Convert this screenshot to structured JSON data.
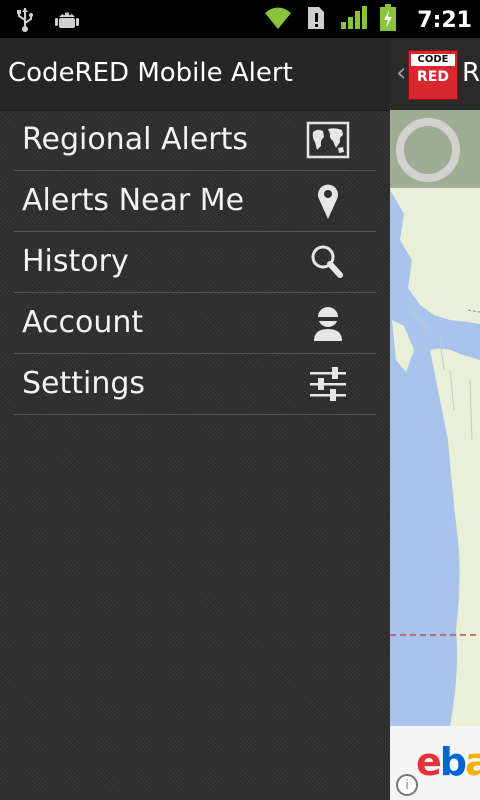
{
  "status_bar": {
    "time": "7:21",
    "icons": [
      "usb-icon",
      "android-debug-icon",
      "wifi-icon",
      "notification-icon",
      "signal-icon",
      "battery-charging-icon"
    ]
  },
  "drawer": {
    "title": "CodeRED Mobile Alert",
    "items": [
      {
        "label": "Regional Alerts",
        "icon": "map-icon"
      },
      {
        "label": "Alerts Near Me",
        "icon": "location-pin-icon"
      },
      {
        "label": "History",
        "icon": "search-icon"
      },
      {
        "label": "Account",
        "icon": "user-icon"
      },
      {
        "label": "Settings",
        "icon": "sliders-icon"
      }
    ]
  },
  "main_screen": {
    "logo": {
      "line1": "CODE",
      "line2": "RED"
    },
    "title_partial": "R",
    "ad_text_partial": "ebay",
    "colors": {
      "logo_red": "#d9272e",
      "map_water": "#a9c4ec",
      "map_land": "#e9f0d7"
    }
  }
}
